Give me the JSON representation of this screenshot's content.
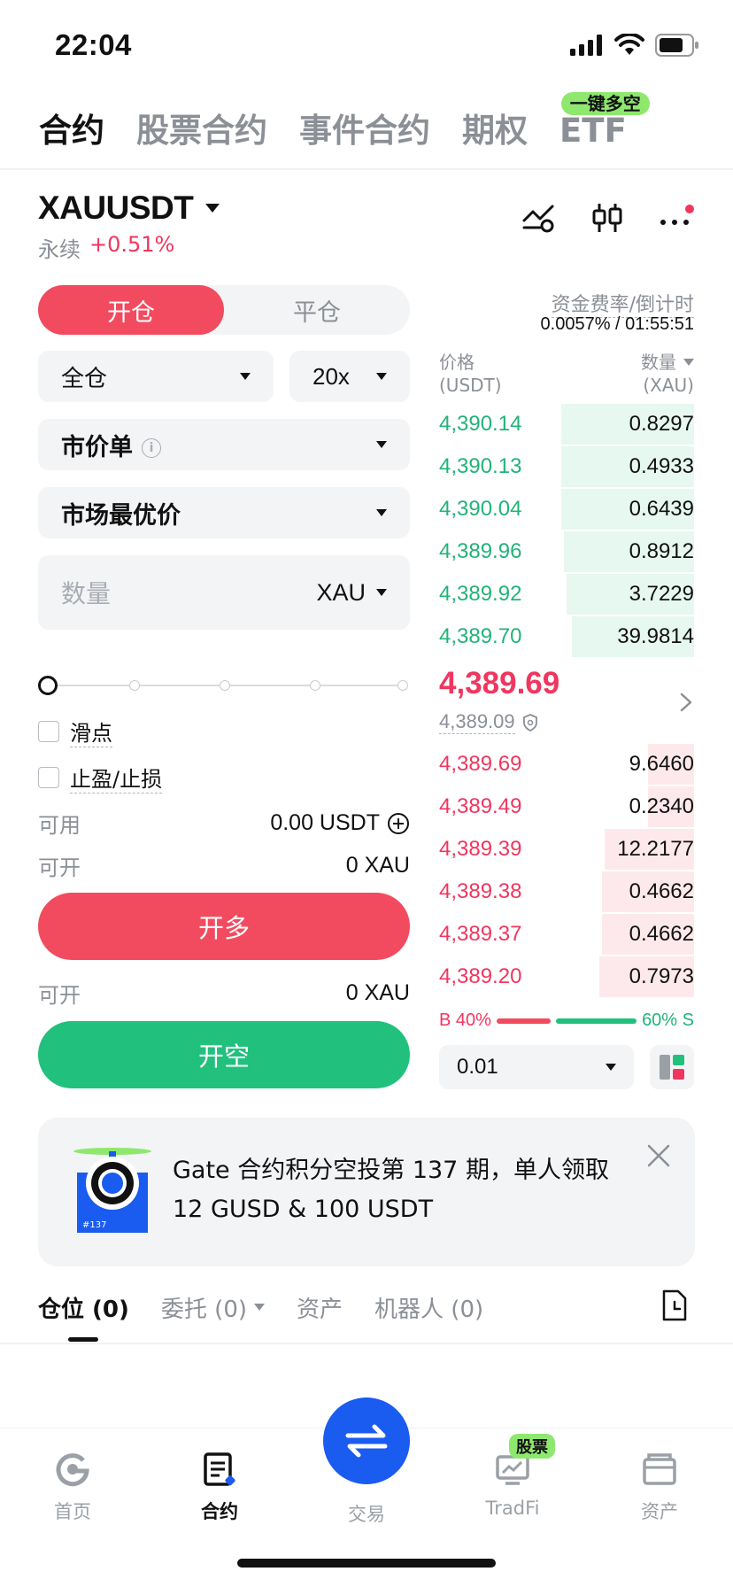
{
  "status_bar": {
    "time": "22:04"
  },
  "top_tabs": {
    "items": [
      "合约",
      "股票合约",
      "事件合约",
      "期权",
      "ETF"
    ],
    "active": "合约",
    "etf_badge": "一键多空"
  },
  "symbol": {
    "name": "XAUUSDT",
    "type": "永续",
    "change": "+0.51%"
  },
  "order_form": {
    "open_label": "开仓",
    "close_label": "平仓",
    "margin_mode": "全仓",
    "leverage": "20x",
    "order_type": "市价单",
    "price_mode": "市场最优价",
    "quantity_placeholder": "数量",
    "quantity_unit": "XAU",
    "slider_levels": 5,
    "slider_value_percent": 0,
    "slippage_label": "滑点",
    "tpsl_label": "止盈/止损",
    "available_label": "可用",
    "available_value": "0.00 USDT",
    "can_open_label": "可开",
    "can_open_long": "0 XAU",
    "can_open_short": "0 XAU",
    "long_button": "开多",
    "short_button": "开空"
  },
  "funding": {
    "label": "资金费率/倒计时",
    "value": "0.0057% / 01:55:51"
  },
  "order_book": {
    "price_header": "价格",
    "price_unit": "(USDT)",
    "qty_header": "数量",
    "qty_unit": "(XAU)",
    "asks": [
      {
        "price": "4,390.14",
        "qty": "0.8297",
        "depth": 0.52
      },
      {
        "price": "4,390.13",
        "qty": "0.4933",
        "depth": 0.52
      },
      {
        "price": "4,390.04",
        "qty": "0.6439",
        "depth": 0.52
      },
      {
        "price": "4,389.96",
        "qty": "0.8912",
        "depth": 0.51
      },
      {
        "price": "4,389.92",
        "qty": "3.7229",
        "depth": 0.5
      },
      {
        "price": "4,389.70",
        "qty": "39.9814",
        "depth": 0.48
      }
    ],
    "last_price": "4,389.69",
    "mark_price": "4,389.09",
    "bids": [
      {
        "price": "4,389.69",
        "qty": "9.6460",
        "depth": 0.18
      },
      {
        "price": "4,389.49",
        "qty": "0.2340",
        "depth": 0.18
      },
      {
        "price": "4,389.39",
        "qty": "12.2177",
        "depth": 0.35
      },
      {
        "price": "4,389.38",
        "qty": "0.4662",
        "depth": 0.36
      },
      {
        "price": "4,389.37",
        "qty": "0.4662",
        "depth": 0.36
      },
      {
        "price": "4,389.20",
        "qty": "0.7973",
        "depth": 0.37
      }
    ],
    "buy_ratio_label": "B 40%",
    "sell_ratio_label": "60% S",
    "buy_ratio": 40,
    "sell_ratio": 60,
    "step": "0.01"
  },
  "promo": {
    "text": "Gate 合约积分空投第 137 期，单人领取 12 GUSD & 100 USDT",
    "badge": "#137"
  },
  "position_tabs": [
    {
      "label": "仓位 (0)",
      "active": true
    },
    {
      "label": "委托 (0)",
      "active": false,
      "dropdown": true
    },
    {
      "label": "资产",
      "active": false
    },
    {
      "label": "机器人 (0)",
      "active": false
    }
  ],
  "nav": {
    "home": "首页",
    "futures": "合约",
    "trade": "交易",
    "tradfi": "TradFi",
    "tradfi_badge": "股票",
    "assets": "资产"
  },
  "colors": {
    "red": "#f24b5f",
    "green": "#22c07d",
    "blue": "#1a5bf0",
    "badge_green": "#8ee86e"
  }
}
